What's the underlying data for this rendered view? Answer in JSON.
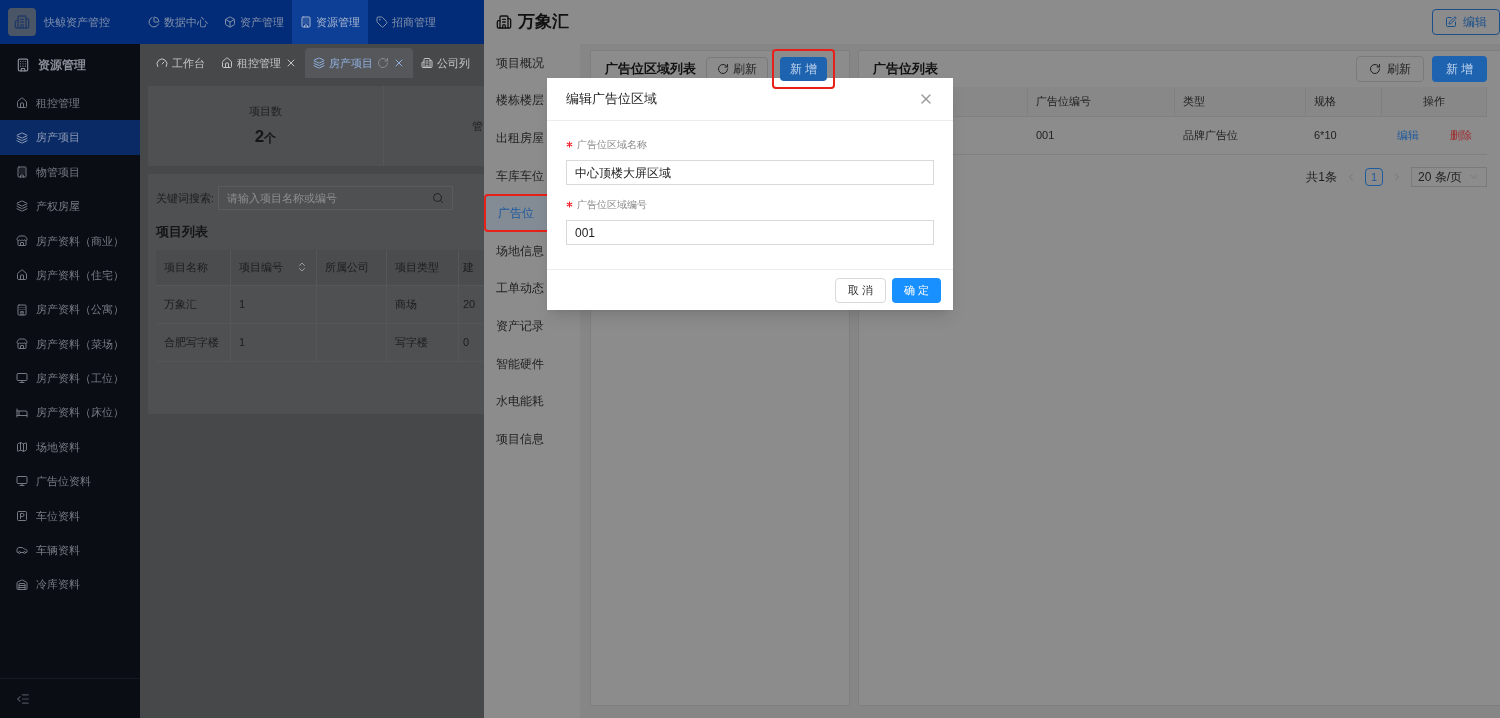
{
  "app": {
    "logo_text": "快鲸资产管控"
  },
  "top_nav": [
    {
      "label": "数据中心",
      "selected": false
    },
    {
      "label": "资产管理",
      "selected": false
    },
    {
      "label": "资源管理",
      "selected": true
    },
    {
      "label": "招商管理",
      "selected": false
    }
  ],
  "sidebar": {
    "title": "资源管理",
    "items": [
      {
        "label": "租控管理",
        "selected": false
      },
      {
        "label": "房产项目",
        "selected": true
      },
      {
        "label": "物管项目",
        "selected": false
      },
      {
        "label": "产权房屋",
        "selected": false
      },
      {
        "label": "房产资料（商业）",
        "selected": false
      },
      {
        "label": "房产资料（住宅）",
        "selected": false
      },
      {
        "label": "房产资料（公寓）",
        "selected": false
      },
      {
        "label": "房产资料（菜场）",
        "selected": false
      },
      {
        "label": "房产资料（工位）",
        "selected": false
      },
      {
        "label": "房产资料（床位）",
        "selected": false
      },
      {
        "label": "场地资料",
        "selected": false
      },
      {
        "label": "广告位资料",
        "selected": false
      },
      {
        "label": "车位资料",
        "selected": false
      },
      {
        "label": "车辆资料",
        "selected": false
      },
      {
        "label": "冷库资料",
        "selected": false
      }
    ]
  },
  "tabs": [
    {
      "label": "工作台",
      "selected": false,
      "closable": false
    },
    {
      "label": "租控管理",
      "selected": false,
      "closable": true
    },
    {
      "label": "房产项目",
      "selected": true,
      "closable": true
    },
    {
      "label": "公司列",
      "selected": false,
      "closable": false
    }
  ],
  "stats": [
    {
      "label": "项目数",
      "value": "2",
      "unit": "个"
    },
    {
      "label": "管"
    }
  ],
  "search": {
    "label": "关键词搜索:",
    "placeholder": "请输入项目名称或编号"
  },
  "project_table": {
    "title": "项目列表",
    "columns": [
      {
        "label": "项目名称",
        "sortable": false
      },
      {
        "label": "项目编号",
        "sortable": true
      },
      {
        "label": "所属公司",
        "sortable": false
      },
      {
        "label": "项目类型",
        "sortable": false
      },
      {
        "label": "建",
        "sortable": false
      }
    ],
    "rows": [
      {
        "name": "万象汇",
        "code": "1",
        "type": "商场",
        "column_5": "20"
      },
      {
        "name": "合肥写字楼",
        "code": "1",
        "type": "写字楼",
        "column_5": "0"
      }
    ]
  },
  "drawer": {
    "title": "万象汇",
    "edit_button": "编辑",
    "nav": [
      {
        "label": "项目概况",
        "selected": false,
        "highlighted": false
      },
      {
        "label": "楼栋楼层",
        "selected": false,
        "highlighted": false
      },
      {
        "label": "出租房屋",
        "selected": false,
        "highlighted": false
      },
      {
        "label": "车库车位",
        "selected": false,
        "highlighted": false
      },
      {
        "label": "广告位",
        "selected": true,
        "highlighted": true
      },
      {
        "label": "场地信息",
        "selected": false,
        "highlighted": false
      },
      {
        "label": "工单动态",
        "selected": false,
        "highlighted": false
      },
      {
        "label": "资产记录",
        "selected": false,
        "highlighted": false
      },
      {
        "label": "智能硬件",
        "selected": false,
        "highlighted": false
      },
      {
        "label": "水电能耗",
        "selected": false,
        "highlighted": false
      },
      {
        "label": "项目信息",
        "selected": false,
        "highlighted": false
      }
    ],
    "area_panel": {
      "title": "广告位区域列表",
      "refresh": "刷新",
      "add": "新 增",
      "add_highlighted": true
    },
    "ad_panel": {
      "title": "广告位列表",
      "refresh": "刷新",
      "add": "新 增",
      "columns": [
        "广告位编号",
        "类型",
        "规格",
        "操作"
      ],
      "rows": [
        {
          "code": "001",
          "type": "品牌广告位",
          "spec": "6*10",
          "edit": "编辑",
          "delete": "删除"
        }
      ],
      "pagination": {
        "total": "共1条",
        "pages": [
          {
            "label": "1",
            "selected": true
          }
        ],
        "page_size": "20 条/页"
      }
    }
  },
  "modal": {
    "title": "编辑广告位区域",
    "fields": [
      {
        "label": "广告位区域名称",
        "required": true,
        "value": "中心顶楼大屏区域"
      },
      {
        "label": "广告位区域编号",
        "required": true,
        "value": "001"
      }
    ],
    "cancel": "取 消",
    "ok": "确 定"
  }
}
